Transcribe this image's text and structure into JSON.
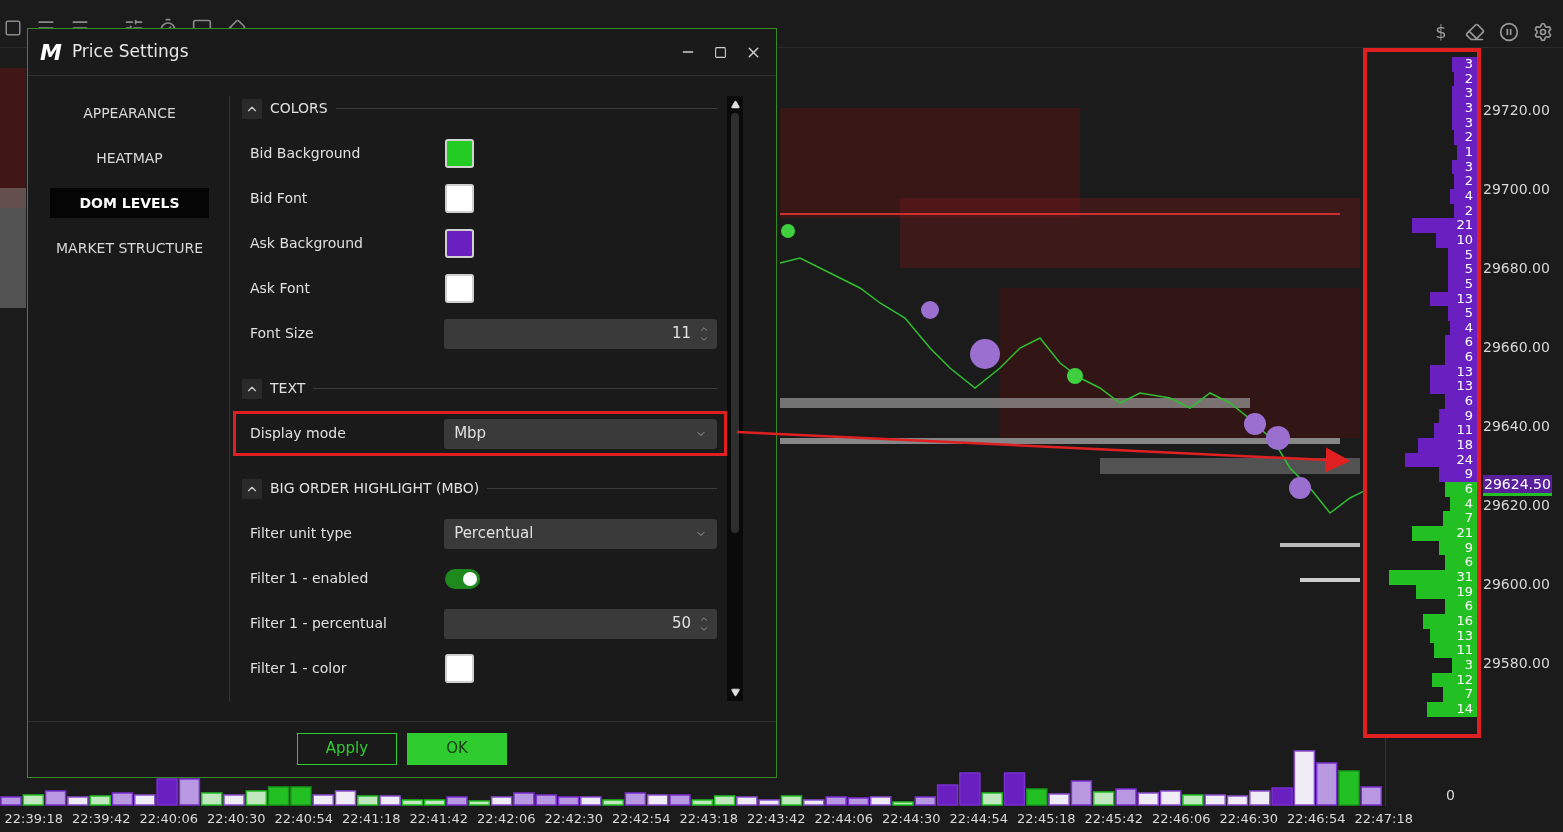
{
  "toolbar": {
    "currency_symbol": "$"
  },
  "dialog": {
    "logo": "M",
    "title": "Price Settings",
    "nav": [
      {
        "label": "APPEARANCE",
        "selected": false
      },
      {
        "label": "HEATMAP",
        "selected": false
      },
      {
        "label": "DOM LEVELS",
        "selected": true
      },
      {
        "label": "MARKET STRUCTURE",
        "selected": false
      }
    ],
    "sections": [
      {
        "title": "COLORS",
        "expanded": true,
        "items": [
          {
            "kind": "color",
            "label": "Bid Background",
            "color": "#22cc22",
            "highlighted": false
          },
          {
            "kind": "color",
            "label": "Bid Font",
            "color": "#ffffff",
            "highlighted": false
          },
          {
            "kind": "color",
            "label": "Ask Background",
            "color": "#6a1fc0",
            "highlighted": false
          },
          {
            "kind": "color",
            "label": "Ask Font",
            "color": "#ffffff",
            "highlighted": false
          },
          {
            "kind": "number",
            "label": "Font Size",
            "value": "11",
            "highlighted": false
          }
        ]
      },
      {
        "title": "TEXT",
        "expanded": true,
        "items": [
          {
            "kind": "select",
            "label": "Display mode",
            "value": "Mbp",
            "highlighted": true
          }
        ]
      },
      {
        "title": "BIG ORDER HIGHLIGHT (MBO)",
        "expanded": true,
        "items": [
          {
            "kind": "select",
            "label": "Filter unit type",
            "value": "Percentual",
            "highlighted": false
          },
          {
            "kind": "toggle",
            "label": "Filter 1 - enabled",
            "on": true,
            "highlighted": false
          },
          {
            "kind": "number",
            "label": "Filter 1 - percentual",
            "value": "50",
            "highlighted": false
          },
          {
            "kind": "color",
            "label": "Filter 1 - color",
            "color": "#ffffff",
            "highlighted": false
          }
        ]
      }
    ],
    "buttons": [
      {
        "label": "Apply",
        "kind": "secondary"
      },
      {
        "label": "OK",
        "kind": "primary"
      }
    ]
  },
  "dom_levels": [
    {
      "size": "3",
      "kind": "ask"
    },
    {
      "size": "2",
      "kind": "ask"
    },
    {
      "size": "3",
      "kind": "ask"
    },
    {
      "size": "3",
      "kind": "ask"
    },
    {
      "size": "3",
      "kind": "ask"
    },
    {
      "size": "2",
      "kind": "ask"
    },
    {
      "size": "1",
      "kind": "ask"
    },
    {
      "size": "3",
      "kind": "ask"
    },
    {
      "size": "2",
      "kind": "ask"
    },
    {
      "size": "4",
      "kind": "ask"
    },
    {
      "size": "2",
      "kind": "ask"
    },
    {
      "size": "21",
      "kind": "ask"
    },
    {
      "size": "10",
      "kind": "ask"
    },
    {
      "size": "5",
      "kind": "ask"
    },
    {
      "size": "5",
      "kind": "ask"
    },
    {
      "size": "5",
      "kind": "ask"
    },
    {
      "size": "13",
      "kind": "ask"
    },
    {
      "size": "5",
      "kind": "ask"
    },
    {
      "size": "4",
      "kind": "ask"
    },
    {
      "size": "6",
      "kind": "ask"
    },
    {
      "size": "6",
      "kind": "ask"
    },
    {
      "size": "13",
      "kind": "ask"
    },
    {
      "size": "13",
      "kind": "ask"
    },
    {
      "size": "6",
      "kind": "ask"
    },
    {
      "size": "9",
      "kind": "ask"
    },
    {
      "size": "11",
      "kind": "ask"
    },
    {
      "size": "18",
      "kind": "ask"
    },
    {
      "size": "24",
      "kind": "ask"
    },
    {
      "size": "9",
      "kind": "ask"
    },
    {
      "size": "6",
      "kind": "bid"
    },
    {
      "size": "4",
      "kind": "bid"
    },
    {
      "size": "7",
      "kind": "bid"
    },
    {
      "size": "21",
      "kind": "bid"
    },
    {
      "size": "9",
      "kind": "bid"
    },
    {
      "size": "6",
      "kind": "bid"
    },
    {
      "size": "31",
      "kind": "bid"
    },
    {
      "size": "19",
      "kind": "bid"
    },
    {
      "size": "6",
      "kind": "bid"
    },
    {
      "size": "16",
      "kind": "bid"
    },
    {
      "size": "13",
      "kind": "bid"
    },
    {
      "size": "11",
      "kind": "bid"
    },
    {
      "size": "3",
      "kind": "bid"
    },
    {
      "size": "12",
      "kind": "bid"
    },
    {
      "size": "7",
      "kind": "bid"
    },
    {
      "size": "14",
      "kind": "bid"
    }
  ],
  "price_axis": [
    "29720.00",
    "29700.00",
    "29680.00",
    "29660.00",
    "29640.00",
    "29620.00",
    "29600.00",
    "29580.00"
  ],
  "current_price": "29624.50",
  "volume_axis": "0",
  "time_axis": [
    "22:39:18",
    "22:39:42",
    "22:40:06",
    "22:40:30",
    "22:40:54",
    "22:41:18",
    "22:41:42",
    "22:42:06",
    "22:42:30",
    "22:42:54",
    "22:43:18",
    "22:43:42",
    "22:44:06",
    "22:44:30",
    "22:44:54",
    "22:45:18",
    "22:45:42",
    "22:46:06",
    "22:46:30",
    "22:46:54",
    "22:47:18"
  ]
}
